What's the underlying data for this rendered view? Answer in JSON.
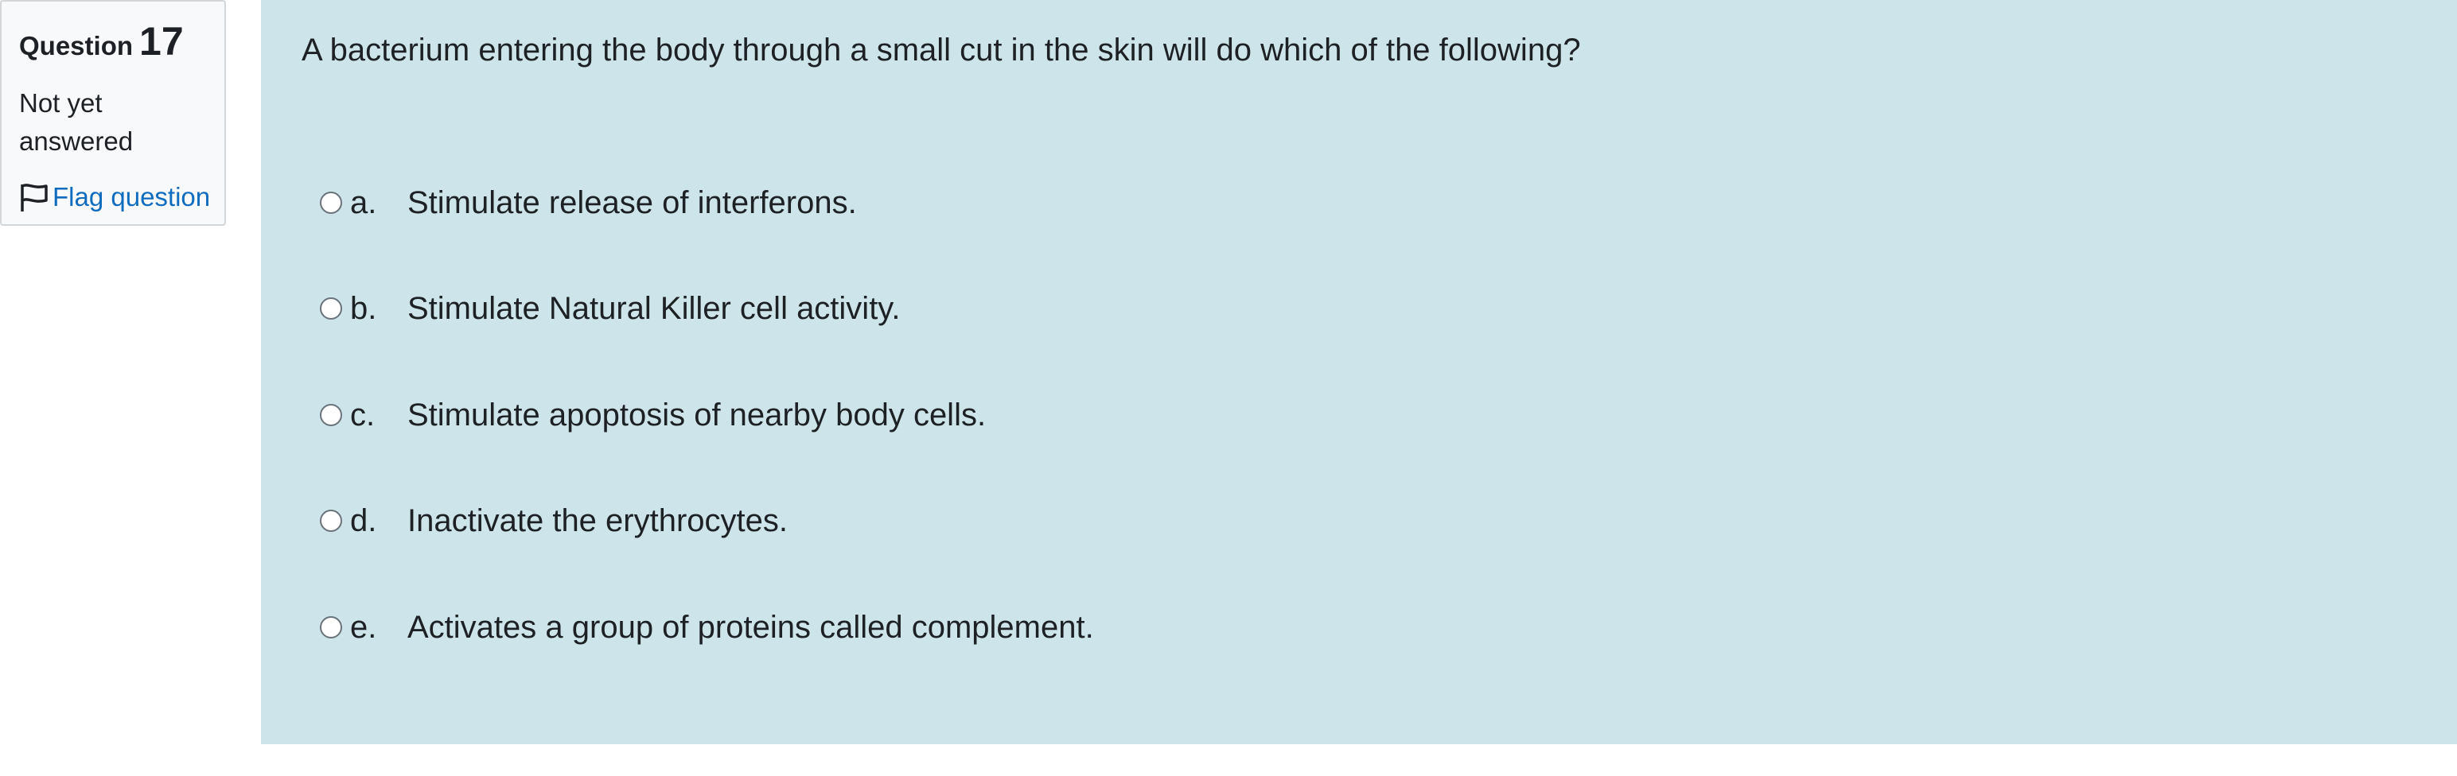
{
  "info": {
    "question_word": "Question",
    "question_number": "17",
    "state": "Not yet answered",
    "flag_label": "Flag question"
  },
  "question": {
    "text": "A bacterium entering the body through a small cut in the skin will do which of the following?"
  },
  "answers": [
    {
      "letter": "a.",
      "text": "Stimulate release of interferons.",
      "selected": false
    },
    {
      "letter": "b.",
      "text": "Stimulate Natural Killer cell activity.",
      "selected": false
    },
    {
      "letter": "c.",
      "text": "Stimulate apoptosis of nearby body cells.",
      "selected": false
    },
    {
      "letter": "d.",
      "text": "Inactivate the erythrocytes.",
      "selected": false
    },
    {
      "letter": "e.",
      "text": "Activates a group of proteins called complement.",
      "selected": false
    }
  ],
  "colors": {
    "panel_background": "#cde5ea",
    "link": "#0f6cbf",
    "info_background": "#f8f9fa"
  },
  "icons": {
    "flag": "flag-icon",
    "radio": "radio-button-icon"
  }
}
